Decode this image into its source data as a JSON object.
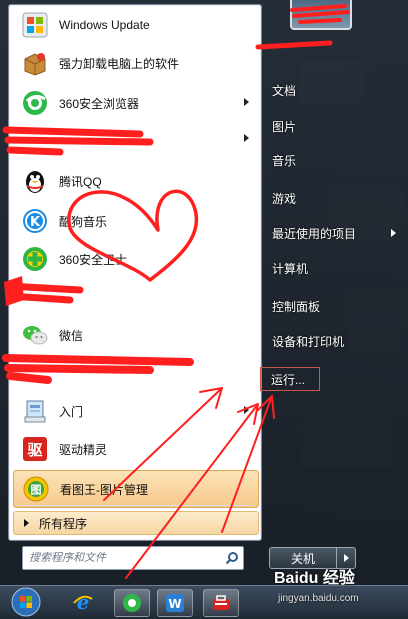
{
  "programs": [
    {
      "label": "Windows Update",
      "icon": "windows-update-icon"
    },
    {
      "label": "强力卸载电脑上的软件",
      "icon": "uninstall-box-icon"
    },
    {
      "label": "360安全浏览器",
      "icon": "360-browser-icon",
      "has_submenu": true
    },
    {
      "label": "",
      "icon": "redacted-icon",
      "has_submenu": true
    },
    {
      "label": "腾讯QQ",
      "icon": "qq-penguin-icon"
    },
    {
      "label": "酷狗音乐",
      "icon": "kugou-music-icon"
    },
    {
      "label": "360安全卫士",
      "icon": "360-safe-icon"
    },
    {
      "label": "",
      "icon": "redacted-icon"
    },
    {
      "label": "微信",
      "icon": "wechat-icon"
    },
    {
      "label": "",
      "icon": "redacted-icon"
    },
    {
      "label": "入门",
      "icon": "getting-started-icon",
      "has_submenu": true
    },
    {
      "label": "驱动精灵",
      "icon": "driver-genius-icon"
    },
    {
      "label": "看图王-图片管理",
      "icon": "image-viewer-icon",
      "highlighted": true
    }
  ],
  "all_programs_label": "所有程序",
  "search": {
    "placeholder": "搜索程序和文件"
  },
  "right_items": [
    {
      "label": "文档"
    },
    {
      "label": "图片"
    },
    {
      "label": "音乐"
    },
    {
      "label": "游戏"
    },
    {
      "label": "最近使用的项目",
      "has_submenu": true
    },
    {
      "label": "计算机"
    },
    {
      "label": "控制面板"
    },
    {
      "label": "设备和打印机"
    },
    {
      "label": "运行..."
    }
  ],
  "shutdown_label": "关机",
  "taskbar": [
    "windows-start-orb-icon",
    "ie-icon",
    "360-browser-icon",
    "wps-icon",
    "toolbox-icon"
  ],
  "watermark": {
    "brand": "Baidu 经验",
    "url": "jingyan.baidu.com"
  },
  "colors": {
    "highlight": "#f7c98b",
    "annotation_red": "#ff1f1f"
  }
}
